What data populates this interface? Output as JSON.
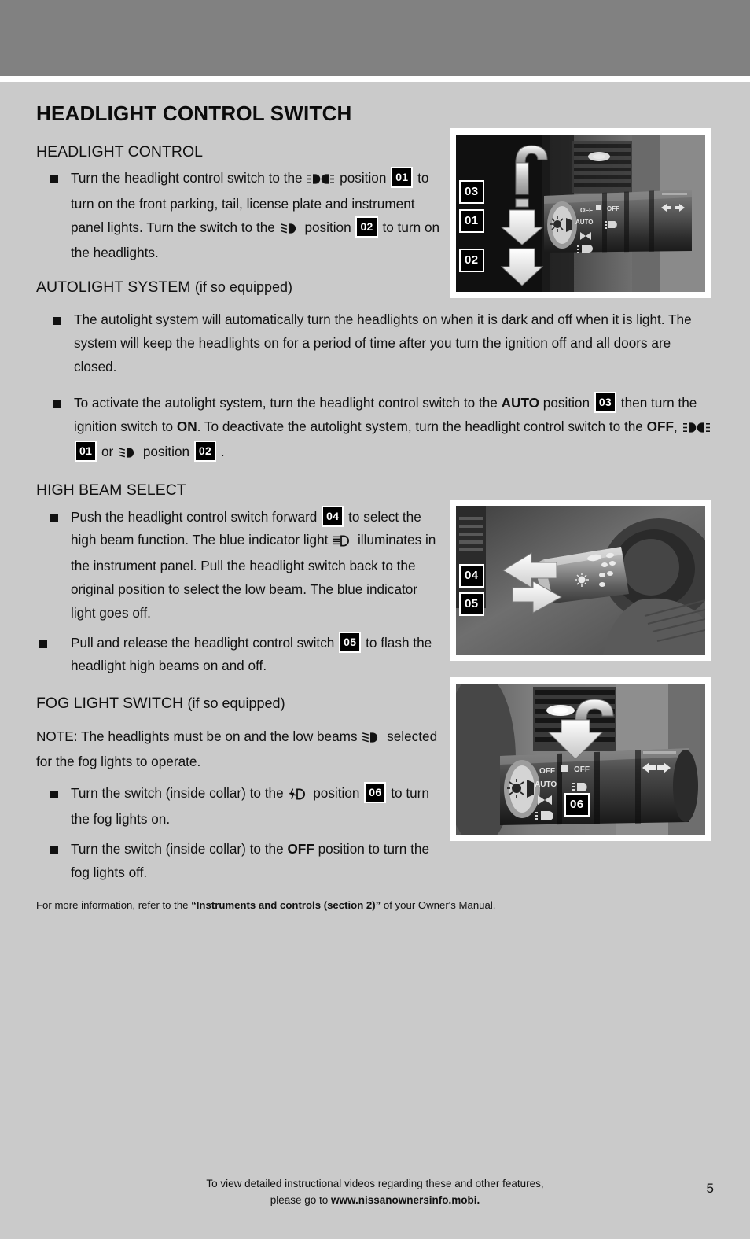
{
  "page": {
    "title": "HEADLIGHT CONTROL SWITCH",
    "number": "5",
    "background_color": "#cacaca",
    "band_color": "#818181"
  },
  "sections": {
    "headlight_control": {
      "heading": "HEADLIGHT CONTROL",
      "bullet1": {
        "t1": "Turn the headlight control switch to the",
        "sym1": "parking-light-symbol",
        "t2": "position",
        "badge1": "01",
        "t3": "to turn on the front parking, tail, license plate and instrument panel lights. Turn the switch to the",
        "sym2": "low-beam-symbol",
        "t4": "position",
        "badge2": "02",
        "t5": "to turn on the headlights."
      }
    },
    "autolight_system": {
      "heading": "AUTOLIGHT SYSTEM",
      "heading_suffix": "(if so equipped)",
      "bullet1": "The autolight system will automatically turn the headlights on when it is dark and off when it is light. The system will keep the headlights on for a period of time after you turn the ignition off and all doors are closed.",
      "bullet2": {
        "t1": "To activate the autolight system, turn the headlight control switch to the",
        "b1": "AUTO",
        "t2": "position",
        "badge1": "03",
        "t3": "then turn the ignition switch to",
        "b2": "ON",
        "t4": ". To deactivate the autolight system, turn the headlight control switch to the",
        "b3": "OFF",
        "t5": ",",
        "sym1": "parking-light-symbol",
        "badge2": "01",
        "t6": "or",
        "sym2": "low-beam-symbol",
        "t7": "position",
        "badge3": "02",
        "t8": "."
      }
    },
    "high_beam_select": {
      "heading": "HIGH BEAM SELECT",
      "bullet1": {
        "t1": "Push the headlight control switch forward",
        "badge1": "04",
        "t2": "to select the high beam function. The blue indicator light",
        "sym1": "high-beam-symbol",
        "t3": "illuminates in the instrument panel. Pull the headlight switch back to the original position to select the low beam. The blue indicator light goes off."
      },
      "bullet2": {
        "t1": "Pull and release the headlight control switch",
        "badge1": "05",
        "t2": "to flash the headlight high beams on and off."
      }
    },
    "fog_light_switch": {
      "heading": "FOG LIGHT SWITCH",
      "heading_suffix": "(if so equipped)",
      "note": {
        "t1": "NOTE: The headlights must be on and the low beams",
        "sym1": "low-beam-symbol",
        "t2": "selected for the fog lights to operate."
      },
      "bullet1": {
        "t1": "Turn the switch (inside collar) to the",
        "sym1": "fog-light-symbol",
        "t2": "position",
        "badge1": "06",
        "t3": "to turn the fog lights on."
      },
      "bullet2": {
        "t1": "Turn the switch (inside collar) to the",
        "b1": "OFF",
        "t2": "position to turn the fog lights off."
      }
    },
    "more_info": {
      "t1": "For more information, refer to the",
      "b1": "“Instruments and controls (section 2)”",
      "t2": "of your Owner's Manual."
    }
  },
  "photos": [
    {
      "name": "headlight-control-stalk-photo",
      "caption_badges": [
        "03",
        "01",
        "02"
      ],
      "switch_labels": [
        "OFF",
        "AUTO",
        "OFF"
      ]
    },
    {
      "name": "high-beam-stalk-photo",
      "caption_badges": [
        "04",
        "05"
      ]
    },
    {
      "name": "fog-light-collar-photo",
      "caption_badges": [
        "06"
      ],
      "switch_labels": [
        "OFF",
        "AUTO",
        "OFF"
      ]
    }
  ],
  "footer": {
    "line1": "To view detailed instructional videos regarding these and other features,",
    "line2_prefix": "please go to",
    "line2_url": "www.nissanownersinfo.mobi."
  }
}
